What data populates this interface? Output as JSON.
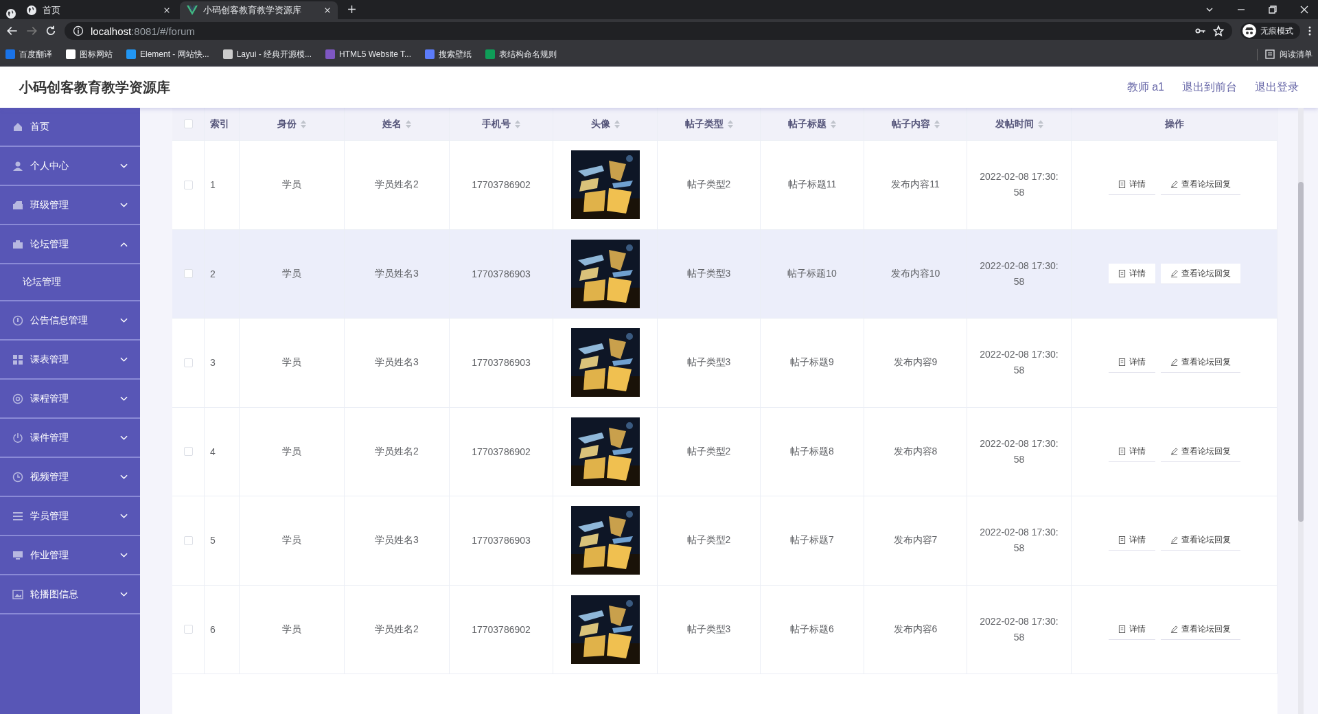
{
  "browser": {
    "tabs": [
      {
        "title": "首页",
        "selected": false
      },
      {
        "title": "小码创客教育教学资源库",
        "selected": true
      }
    ],
    "url_host": "localhost",
    "url_rest": ":8081/#/forum",
    "profile_label": "无痕模式",
    "bookmarks": [
      "百度翻译",
      "图标网站",
      "Element - 网站快...",
      "Layui - 经典开源模...",
      "HTML5 Website T...",
      "搜索壁纸",
      "表结构命名规则"
    ],
    "reading_list": "阅读清单"
  },
  "header": {
    "title": "小码创客教育教学资源库",
    "links": [
      "教师 a1",
      "退出到前台",
      "退出登录"
    ]
  },
  "sidebar": {
    "items": [
      {
        "label": "首页",
        "expandable": false
      },
      {
        "label": "个人中心",
        "expandable": true,
        "expanded": false
      },
      {
        "label": "班级管理",
        "expandable": true,
        "expanded": false
      },
      {
        "label": "论坛管理",
        "expandable": true,
        "expanded": true,
        "children": [
          {
            "label": "论坛管理"
          }
        ]
      },
      {
        "label": "公告信息管理",
        "expandable": true,
        "expanded": false
      },
      {
        "label": "课表管理",
        "expandable": true,
        "expanded": false
      },
      {
        "label": "课程管理",
        "expandable": true,
        "expanded": false
      },
      {
        "label": "课件管理",
        "expandable": true,
        "expanded": false
      },
      {
        "label": "视频管理",
        "expandable": true,
        "expanded": false
      },
      {
        "label": "学员管理",
        "expandable": true,
        "expanded": false
      },
      {
        "label": "作业管理",
        "expandable": true,
        "expanded": false
      },
      {
        "label": "轮播图信息",
        "expandable": true,
        "expanded": false
      }
    ]
  },
  "table": {
    "header_checked": false,
    "columns": [
      {
        "label": "索引",
        "sortable": false
      },
      {
        "label": "身份",
        "sortable": true
      },
      {
        "label": "姓名",
        "sortable": true
      },
      {
        "label": "手机号",
        "sortable": true
      },
      {
        "label": "头像",
        "sortable": true
      },
      {
        "label": "帖子类型",
        "sortable": true
      },
      {
        "label": "帖子标题",
        "sortable": true
      },
      {
        "label": "帖子内容",
        "sortable": true
      },
      {
        "label": "发帖时间",
        "sortable": true
      },
      {
        "label": "操作",
        "sortable": false
      }
    ],
    "rows": [
      {
        "checked": false,
        "highlighted": false,
        "index": "1",
        "identity": "学员",
        "name": "学员姓名2",
        "phone": "17703786902",
        "post_type": "帖子类型2",
        "post_title": "帖子标题11",
        "post_content": "发布内容11",
        "time": "2022-02-08 17:30:58",
        "actions": [
          "详情",
          "查看论坛回复"
        ]
      },
      {
        "checked": false,
        "highlighted": true,
        "index": "2",
        "identity": "学员",
        "name": "学员姓名3",
        "phone": "17703786903",
        "post_type": "帖子类型3",
        "post_title": "帖子标题10",
        "post_content": "发布内容10",
        "time": "2022-02-08 17:30:58",
        "actions": [
          "详情",
          "查看论坛回复"
        ]
      },
      {
        "checked": false,
        "highlighted": false,
        "index": "3",
        "identity": "学员",
        "name": "学员姓名3",
        "phone": "17703786903",
        "post_type": "帖子类型3",
        "post_title": "帖子标题9",
        "post_content": "发布内容9",
        "time": "2022-02-08 17:30:58",
        "actions": [
          "详情",
          "查看论坛回复"
        ]
      },
      {
        "checked": false,
        "highlighted": false,
        "index": "4",
        "identity": "学员",
        "name": "学员姓名2",
        "phone": "17703786902",
        "post_type": "帖子类型2",
        "post_title": "帖子标题8",
        "post_content": "发布内容8",
        "time": "2022-02-08 17:30:58",
        "actions": [
          "详情",
          "查看论坛回复"
        ]
      },
      {
        "checked": false,
        "highlighted": false,
        "index": "5",
        "identity": "学员",
        "name": "学员姓名3",
        "phone": "17703786903",
        "post_type": "帖子类型2",
        "post_title": "帖子标题7",
        "post_content": "发布内容7",
        "time": "2022-02-08 17:30:58",
        "actions": [
          "详情",
          "查看论坛回复"
        ]
      },
      {
        "checked": false,
        "highlighted": false,
        "index": "6",
        "identity": "学员",
        "name": "学员姓名2",
        "phone": "17703786902",
        "post_type": "帖子类型3",
        "post_title": "帖子标题6",
        "post_content": "发布内容6",
        "time": "2022-02-08 17:30:58",
        "actions": [
          "详情",
          "查看论坛回复"
        ]
      }
    ]
  }
}
